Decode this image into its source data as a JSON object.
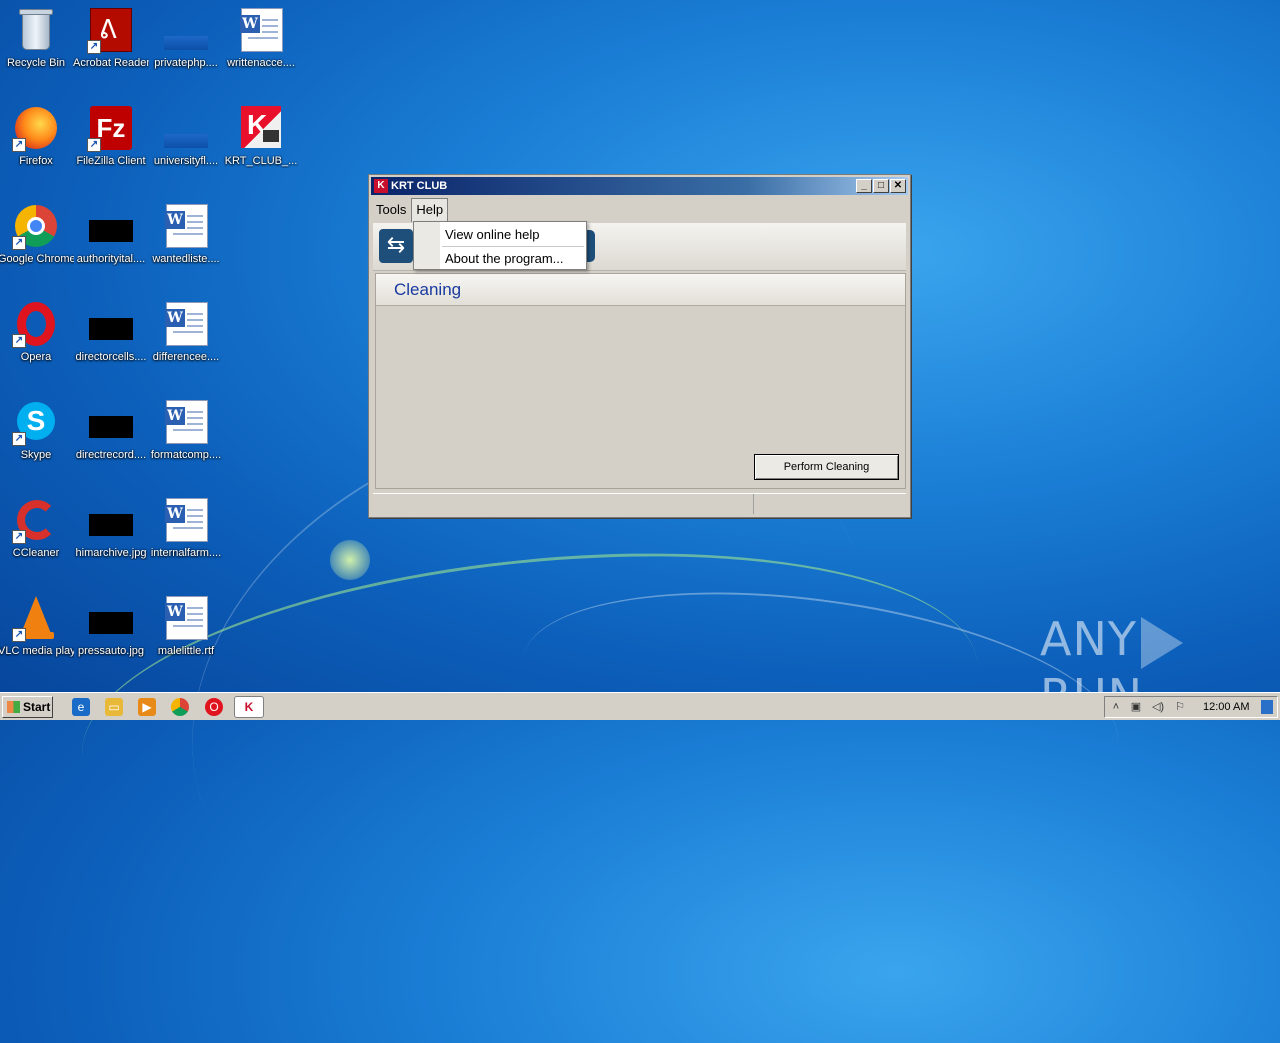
{
  "desktop": {
    "icons": [
      {
        "label": "Recycle Bin",
        "icon": "recycle-bin-icon"
      },
      {
        "label": "Acrobat Reader DC",
        "icon": "acrobat-icon"
      },
      {
        "label": "privatephp....",
        "icon": "file-icon"
      },
      {
        "label": "writtenacce....",
        "icon": "word-doc-icon"
      },
      {
        "label": "Firefox",
        "icon": "firefox-icon"
      },
      {
        "label": "FileZilla Client",
        "icon": "filezilla-icon"
      },
      {
        "label": "universityfl....",
        "icon": "file-icon"
      },
      {
        "label": "KRT_CLUB_...",
        "icon": "krt-club-icon"
      },
      {
        "label": "Google Chrome",
        "icon": "chrome-icon"
      },
      {
        "label": "authorityital....",
        "icon": "image-file-icon"
      },
      {
        "label": "wantedliste....",
        "icon": "word-doc-icon"
      },
      {
        "label": "Opera",
        "icon": "opera-icon"
      },
      {
        "label": "directorcells....",
        "icon": "image-file-icon"
      },
      {
        "label": "differencee....",
        "icon": "word-doc-icon"
      },
      {
        "label": "Skype",
        "icon": "skype-icon"
      },
      {
        "label": "directrecord....",
        "icon": "image-file-icon"
      },
      {
        "label": "formatcomp....",
        "icon": "word-doc-icon"
      },
      {
        "label": "CCleaner",
        "icon": "ccleaner-icon"
      },
      {
        "label": "himarchive.jpg",
        "icon": "image-file-icon"
      },
      {
        "label": "internalfarm....",
        "icon": "word-doc-icon"
      },
      {
        "label": "VLC media player",
        "icon": "vlc-icon"
      },
      {
        "label": "pressauto.jpg",
        "icon": "image-file-icon"
      },
      {
        "label": "malelittle.rtf",
        "icon": "word-doc-icon"
      }
    ]
  },
  "window": {
    "title": "KRT CLUB",
    "minimize": "_",
    "maximize": "□",
    "close": "✕",
    "menus": [
      "Tools",
      "Help"
    ],
    "panel_title": "Cleaning",
    "perform_button": "Perform Cleaning"
  },
  "help_menu": {
    "items": [
      "View online help",
      "About the program..."
    ]
  },
  "taskbar": {
    "start_label": "Start",
    "clock": "12:00 AM"
  },
  "watermark": {
    "left": "ANY",
    "right": "RUN"
  }
}
